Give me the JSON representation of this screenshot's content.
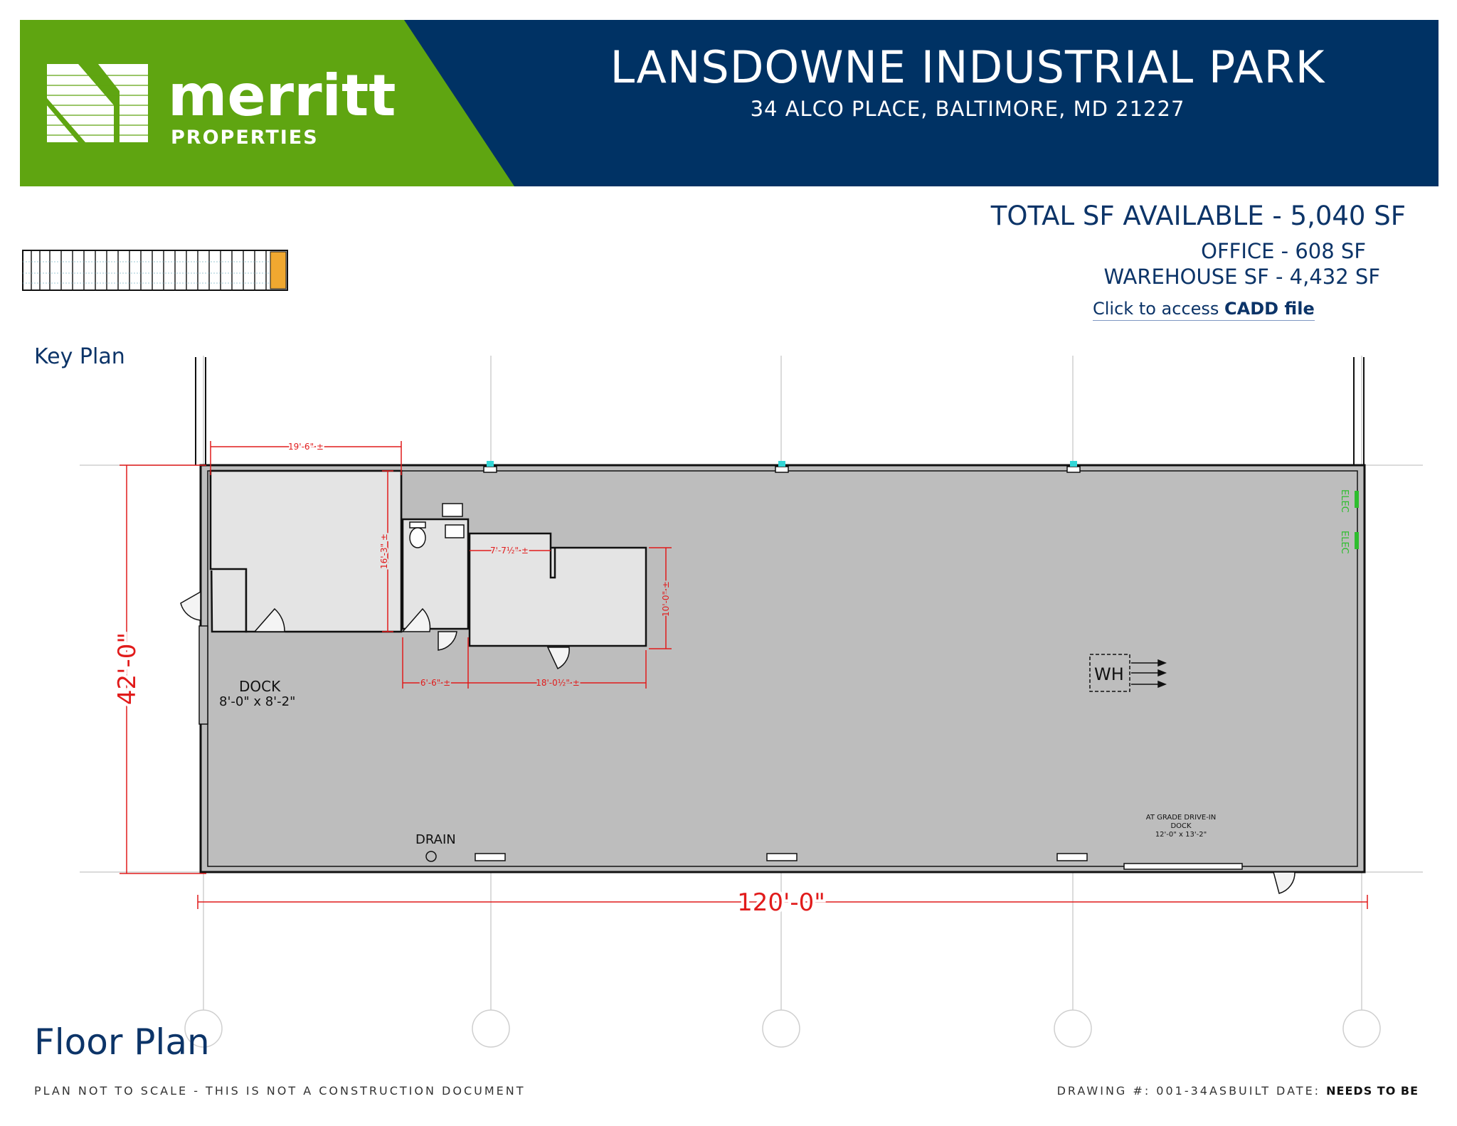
{
  "brand": {
    "name": "merritt",
    "sub": "PROPERTIES",
    "green": "#5fa511",
    "navy": "#003264"
  },
  "header": {
    "title": "LANSDOWNE INDUSTRIAL PARK",
    "address": "34 ALCO PLACE,  BALTIMORE, MD  21227"
  },
  "availability": {
    "total": "TOTAL SF AVAILABLE - 5,040 SF",
    "office": "OFFICE -  608 SF",
    "warehouse": "WAREHOUSE SF -  4,432 SF",
    "cadd_prefix": "Click to access ",
    "cadd_link": "CADD file"
  },
  "labels": {
    "key_plan": "Key Plan",
    "floor_plan": "Floor Plan",
    "disclaimer": "PLAN NOT TO SCALE - THIS IS NOT A CONSTRUCTION DOCUMENT",
    "drawing_prefix": "DRAWING #: 001-34ASBUILT DATE: ",
    "drawing_date": "NEEDS TO BE"
  },
  "plan": {
    "width_dim": "120'-0\"",
    "height_dim": "42'-0\"",
    "dim_office_width": "19'-6\" ±",
    "dim_office_height": "16'-3\" ±",
    "dim_room_width": "7'-7½\" ±",
    "dim_room_height": "10'-0\" ±",
    "dim_restroom": "6'-6\" ±",
    "dim_office2": "18'-0½\" ±",
    "dock_label": "DOCK",
    "dock_size": "8'-0\" x 8'-2\"",
    "drain": "DRAIN",
    "wh": "WH",
    "elec": "ELEC",
    "drive_in_1": "AT GRADE DRIVE-IN",
    "drive_in_2": "DOCK",
    "drive_in_3": "12'-0\" x 13'-2\""
  }
}
